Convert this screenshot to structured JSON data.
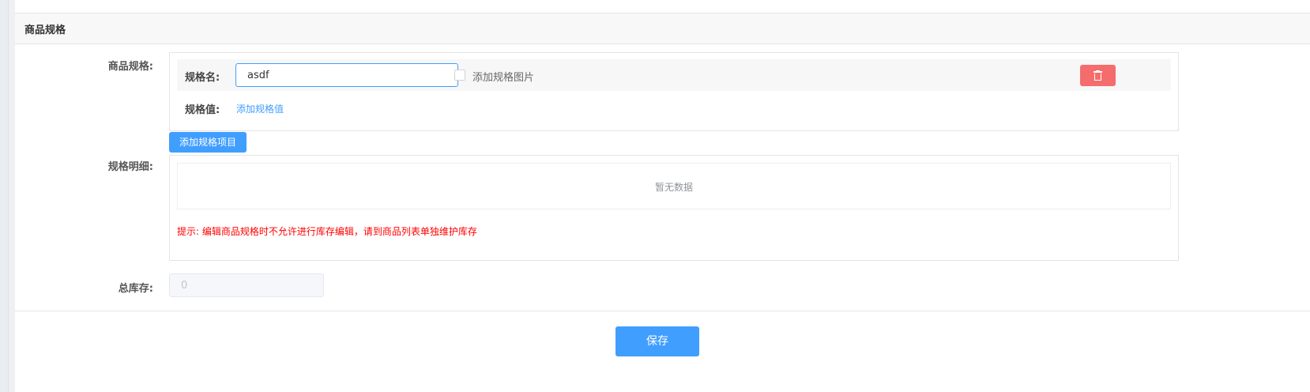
{
  "section": {
    "title": "商品规格"
  },
  "spec_form": {
    "label": "商品规格:",
    "name_label": "规格名:",
    "name_value": "asdf",
    "add_image_label": "添加规格图片",
    "value_label": "规格值:",
    "add_value_link": "添加规格值",
    "add_item_button": "添加规格项目"
  },
  "detail": {
    "label": "规格明细:",
    "empty_text": "暂无数据",
    "tip": "提示: 编辑商品规格时不允许进行库存编辑，请到商品列表单独维护库存"
  },
  "stock": {
    "label": "总库存:",
    "value": "0"
  },
  "actions": {
    "save_label": "保存"
  },
  "colors": {
    "primary": "#409eff",
    "danger": "#f56c6c",
    "tip": "#ff0000"
  },
  "icons": {
    "delete": "trash-icon"
  }
}
